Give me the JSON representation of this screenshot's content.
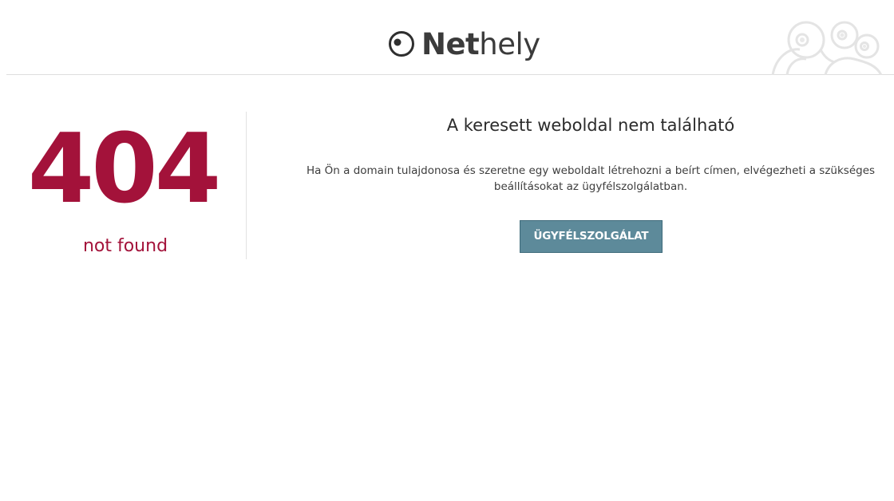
{
  "header": {
    "logo": {
      "bold": "Net",
      "regular": "hely"
    },
    "mascot_icon": "mascot-illustration"
  },
  "error": {
    "code": "404",
    "subtitle": "not found"
  },
  "content": {
    "title": "A keresett weboldal nem található",
    "description": "Ha Ön a domain tulajdonosa és szeretne egy weboldalt létrehozni a beírt címen, elvégezheti a szükséges beállításokat az ügyfélszolgálatban.",
    "button_label": "ÜGYFÉLSZOLGÁLAT"
  },
  "colors": {
    "error_red": "#a3123a",
    "button_bg": "#5d8a9a",
    "text_dark": "#2b2b2b"
  }
}
